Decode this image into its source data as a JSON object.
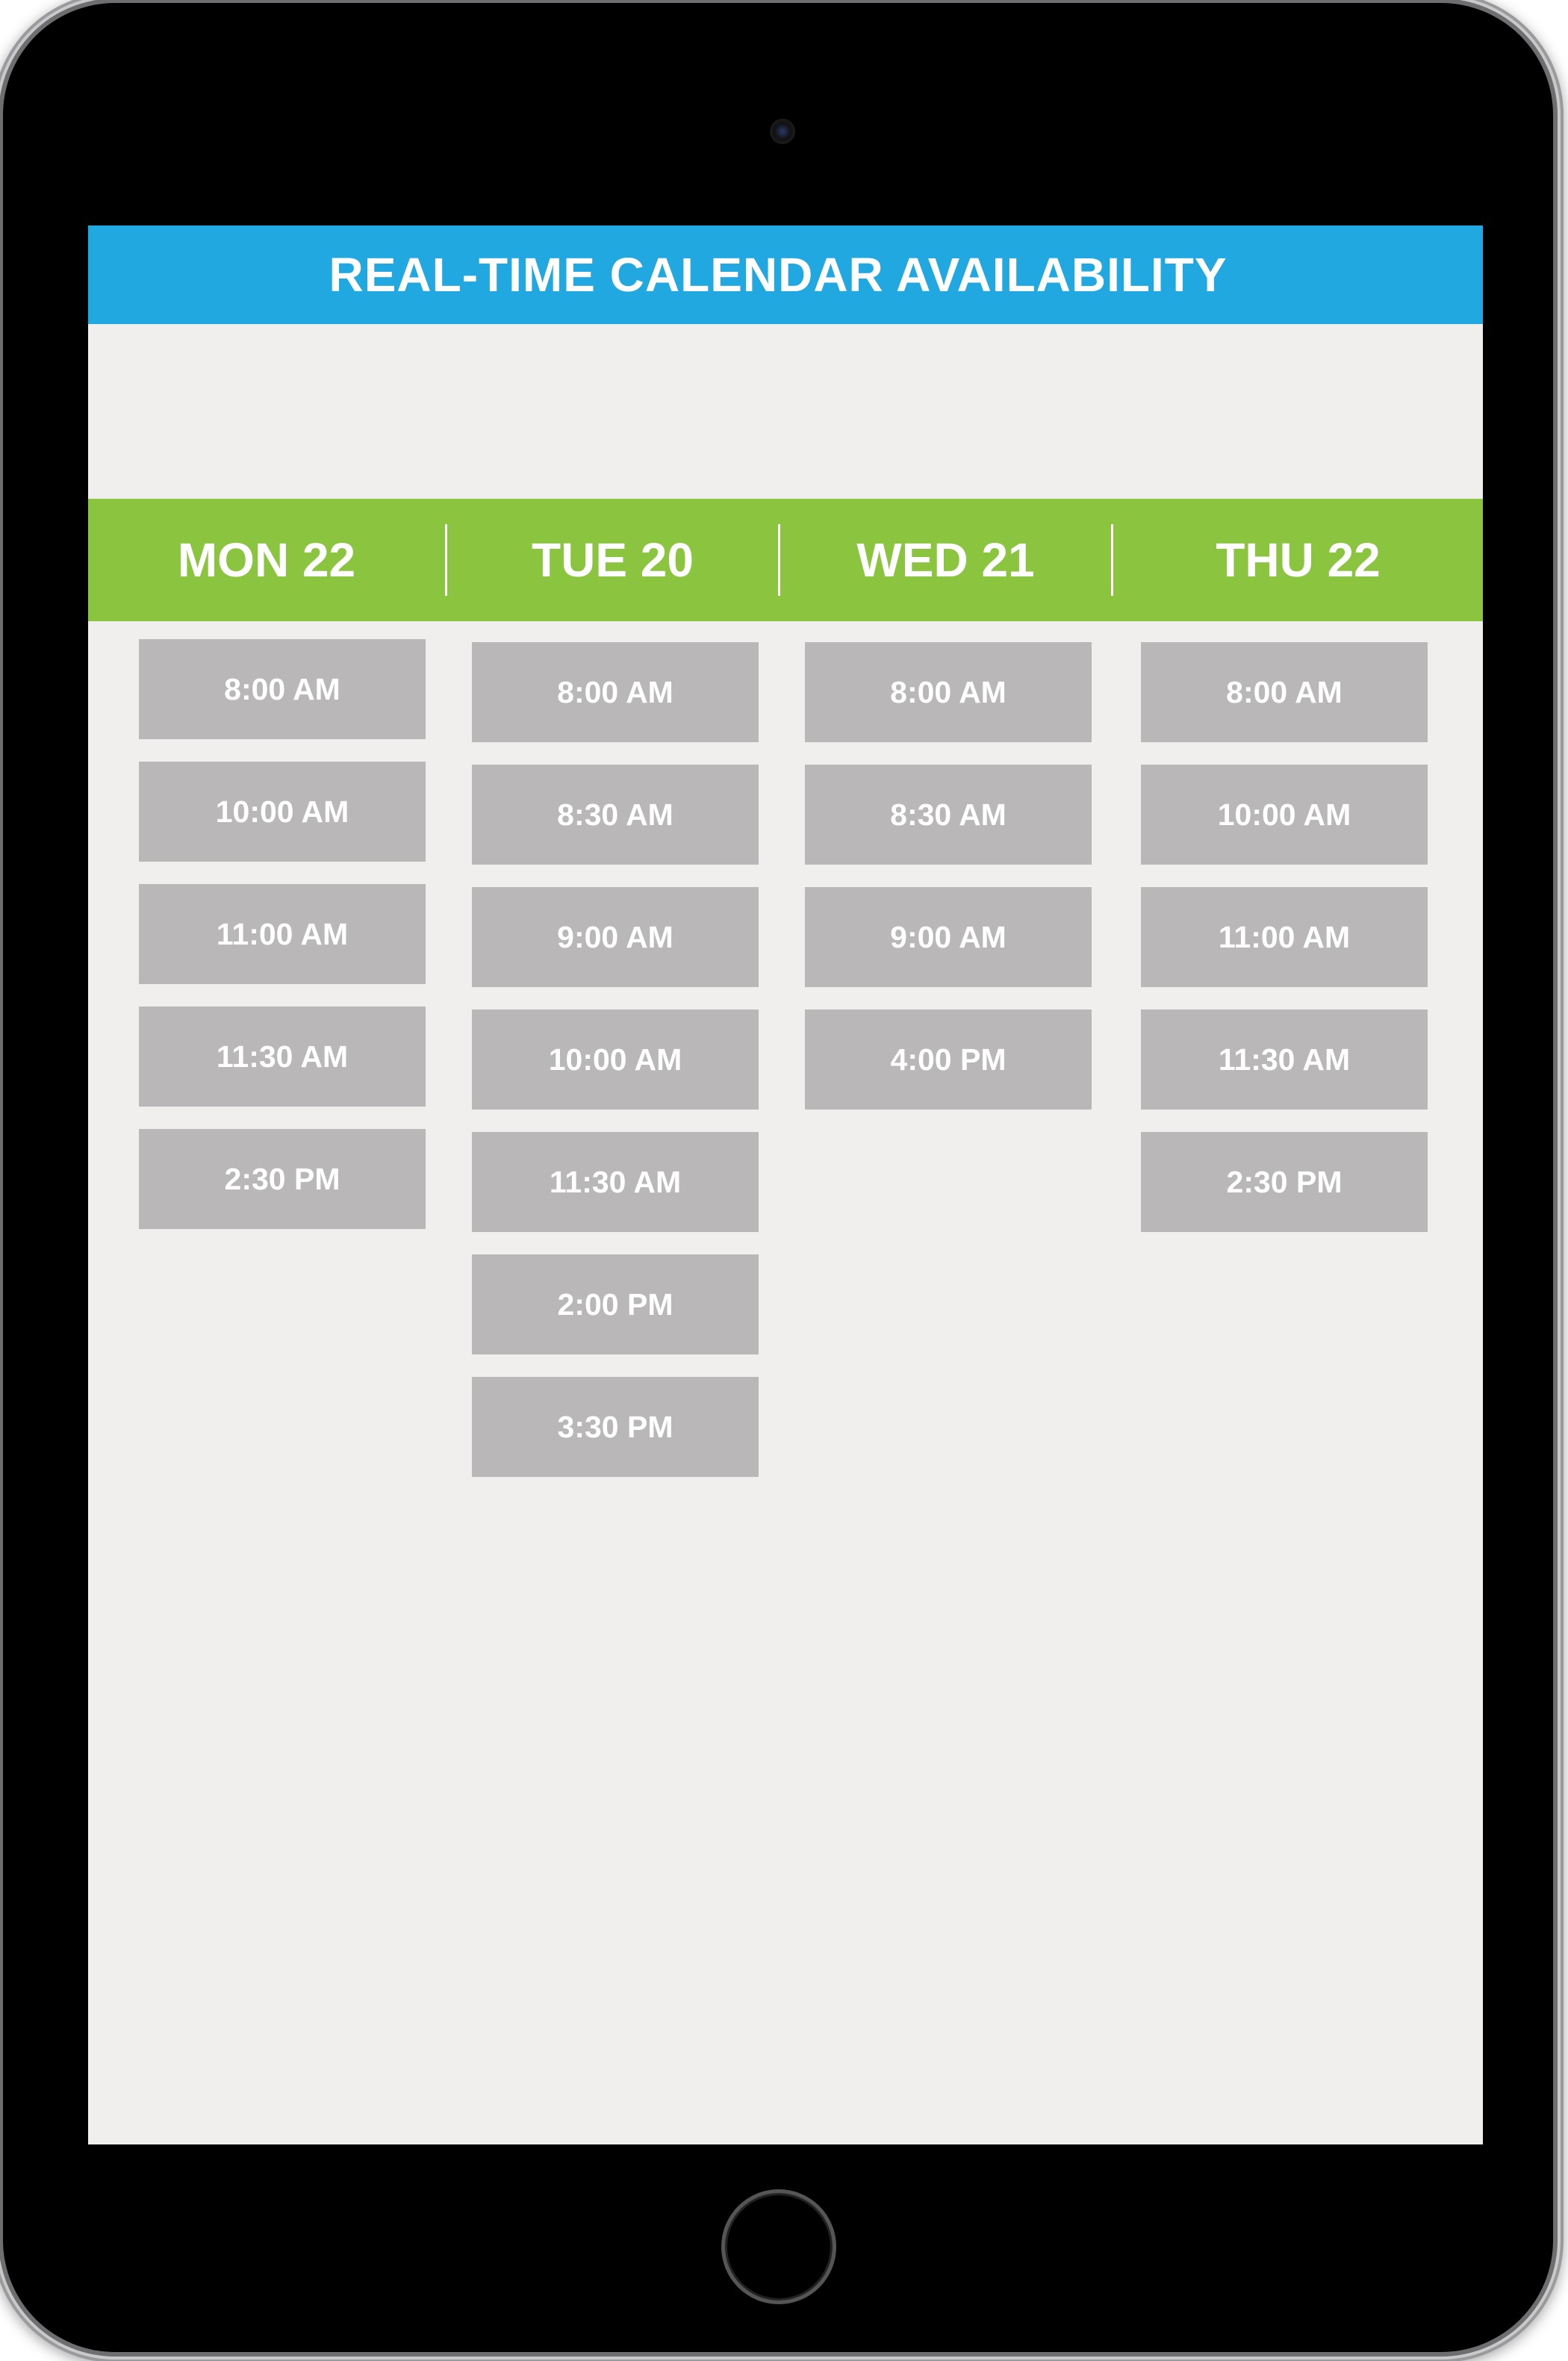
{
  "header": {
    "title": "REAL-TIME CALENDAR AVAILABILITY"
  },
  "colors": {
    "title_bar": "#22a8e0",
    "days_bar": "#8bc43f",
    "slot": "#b9b7b7",
    "screen_bg": "#f0efee"
  },
  "days": [
    {
      "label": "MON 22",
      "slots": [
        "8:00 AM",
        "10:00 AM",
        "11:00 AM",
        "11:30 AM",
        "2:30 PM"
      ]
    },
    {
      "label": "TUE 20",
      "slots": [
        "8:00 AM",
        "8:30 AM",
        "9:00 AM",
        "10:00 AM",
        "11:30 AM",
        "2:00 PM",
        "3:30 PM"
      ]
    },
    {
      "label": "WED 21",
      "slots": [
        "8:00 AM",
        "8:30 AM",
        "9:00 AM",
        "4:00 PM"
      ]
    },
    {
      "label": "THU 22",
      "slots": [
        "8:00 AM",
        "10:00 AM",
        "11:00 AM",
        "11:30 AM",
        "2:30 PM"
      ]
    }
  ],
  "icons": {
    "camera": "camera-icon",
    "home": "home-button-icon"
  }
}
